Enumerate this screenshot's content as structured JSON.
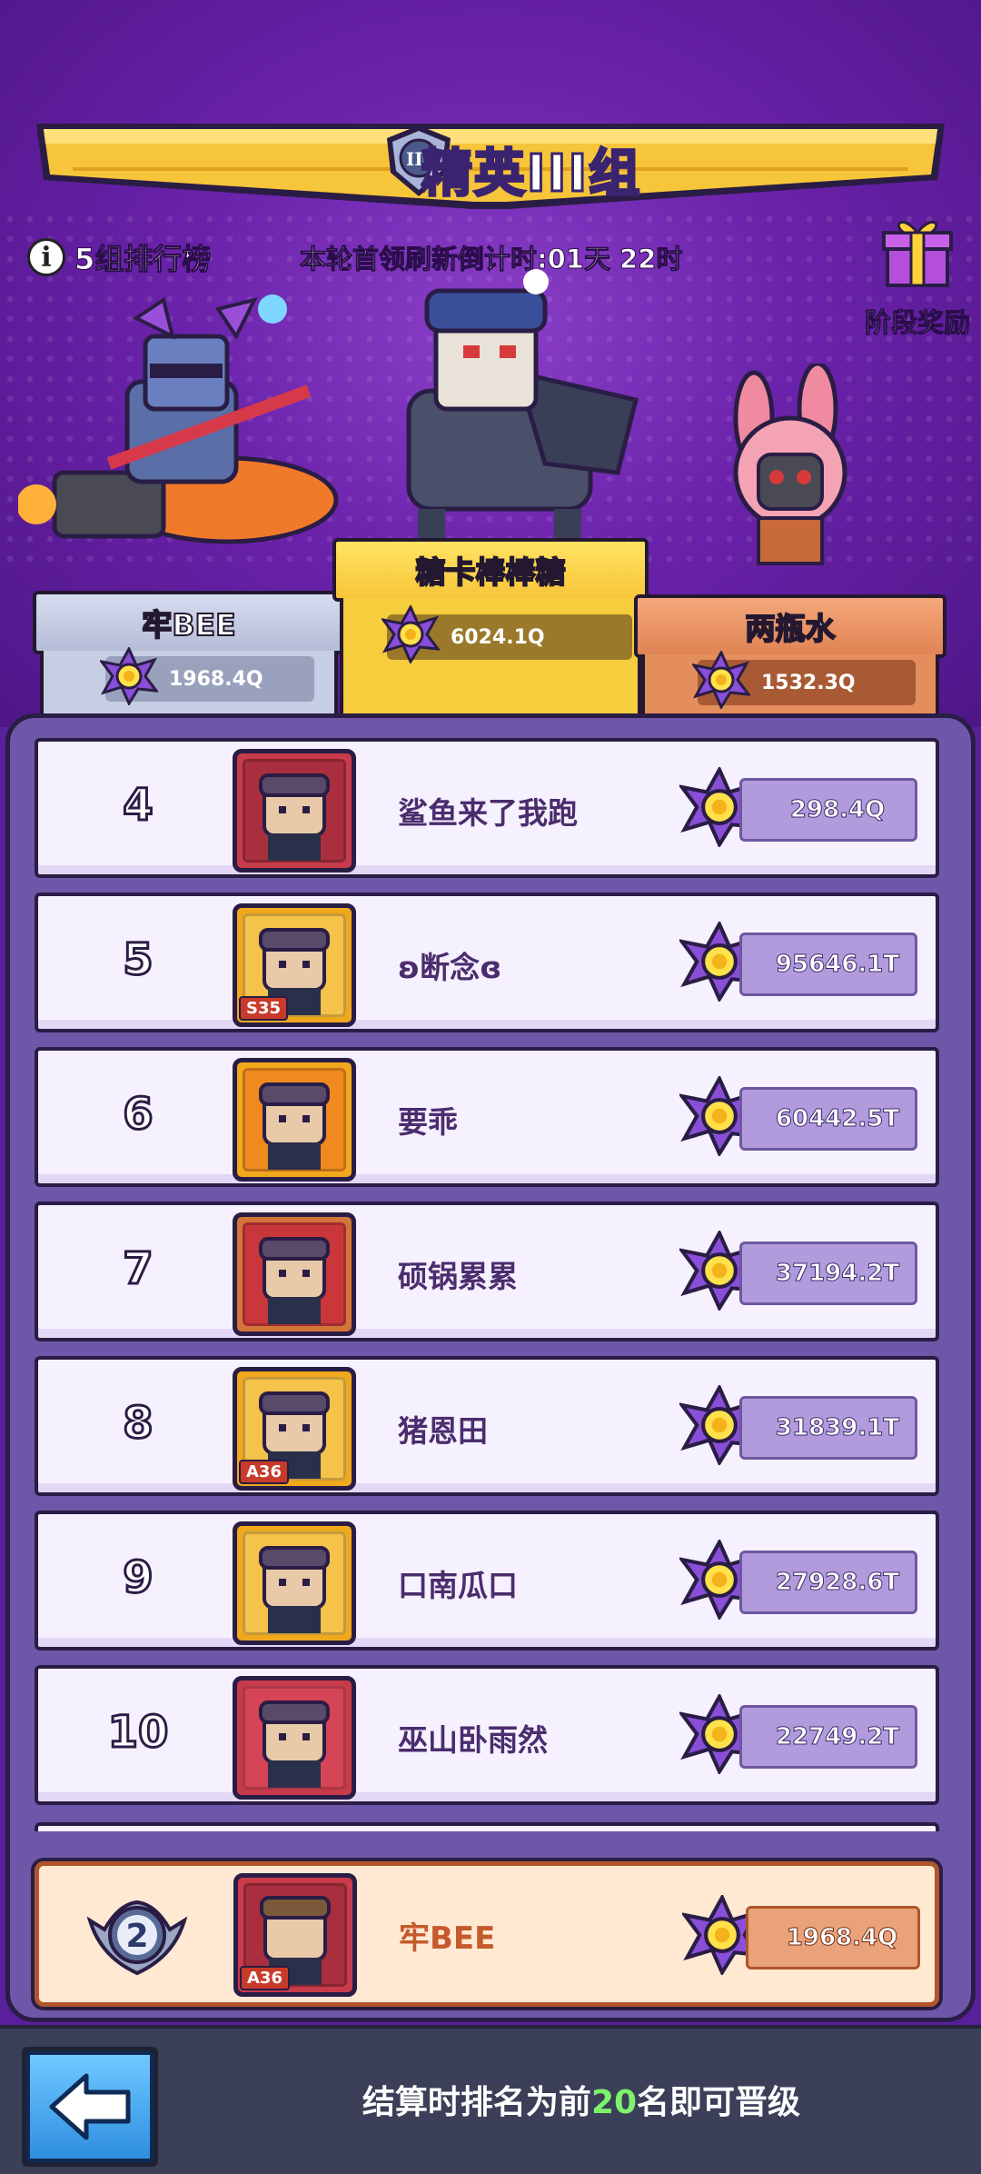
{
  "banner": {
    "title": "精英III组",
    "tier_numeral": "III"
  },
  "leaderboard_link": {
    "label": "5组排行榜",
    "icon": "info-icon"
  },
  "countdown": "本轮首领刷新倒计时:01天 22时",
  "stage_reward": {
    "label": "阶段奖励",
    "icon": "gift-icon"
  },
  "podium": [
    {
      "place": 1,
      "name": "糖卡棒棒糖",
      "score": "6024.1Q"
    },
    {
      "place": 2,
      "name": "牢BEE",
      "score": "1968.4Q"
    },
    {
      "place": 3,
      "name": "两瓶水",
      "score": "1532.3Q"
    }
  ],
  "rows": [
    {
      "rank": "4",
      "name": "鲨鱼来了我跑",
      "score": "298.4Q",
      "frame": "#c83b4a",
      "bg": "#a92f3e",
      "badge": ""
    },
    {
      "rank": "5",
      "name": "ʚ断念ɞ",
      "score": "95646.1T",
      "frame": "#f1a81d",
      "bg": "#f5c24a",
      "badge": "S35"
    },
    {
      "rank": "6",
      "name": "要乖",
      "score": "60442.5T",
      "frame": "#f1a81d",
      "bg": "#f08a1f",
      "badge": ""
    },
    {
      "rank": "7",
      "name": "硕锅累累",
      "score": "37194.2T",
      "frame": "#d3743a",
      "bg": "#c9373a",
      "badge": ""
    },
    {
      "rank": "8",
      "name": "猪恩田",
      "score": "31839.1T",
      "frame": "#f1a81d",
      "bg": "#f5c24a",
      "badge": "A36"
    },
    {
      "rank": "9",
      "name": "口南瓜口",
      "score": "27928.6T",
      "frame": "#f1a81d",
      "bg": "#f5c24a",
      "badge": ""
    },
    {
      "rank": "10",
      "name": "巫山卧雨然",
      "score": "22749.2T",
      "frame": "#c83b4a",
      "bg": "#d64557",
      "badge": ""
    }
  ],
  "my_row": {
    "rank": "2",
    "name": "牢BEE",
    "score": "1968.4Q",
    "badge": "A36"
  },
  "footer": {
    "text_before": "结算时排名为前",
    "highlight": "20",
    "text_after": "名即可晋级"
  },
  "colors": {
    "accent": "#6a22aa",
    "banner": "#f7c53a",
    "highlight": "#7cf36a"
  }
}
